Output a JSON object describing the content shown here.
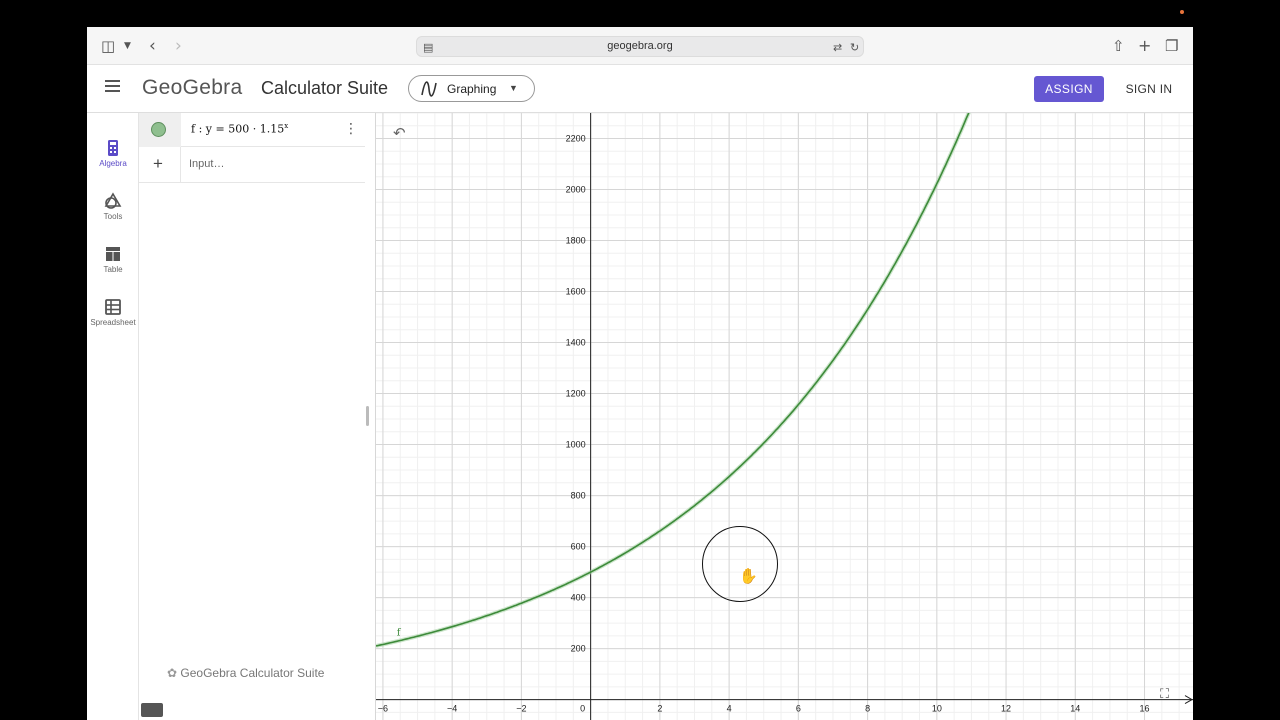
{
  "browser": {
    "url": "geogebra.org",
    "icons": [
      "sidebar-icon",
      "chevron-down-icon",
      "back-icon",
      "forward-icon",
      "site-settings-icon",
      "lock-icon",
      "translate-icon",
      "reload-icon",
      "share-icon",
      "new-tab-icon",
      "tabs-overview-icon"
    ]
  },
  "header": {
    "logo": "GeoGebra",
    "title": "Calculator Suite",
    "app_selector": "Graphing",
    "assign_label": "ASSIGN",
    "signin_label": "SIGN IN",
    "accent": "#6557d2"
  },
  "sidebar": {
    "items": [
      {
        "label": "Algebra",
        "icon": "calculator-icon",
        "active": true
      },
      {
        "label": "Tools",
        "icon": "tools-icon",
        "active": false
      },
      {
        "label": "Table",
        "icon": "table-icon",
        "active": false
      },
      {
        "label": "Spreadsheet",
        "icon": "spreadsheet-icon",
        "active": false
      }
    ]
  },
  "algebra": {
    "name": "f",
    "lhs": "y",
    "coefficient": "500",
    "base": "1.15",
    "exponent": "x",
    "input_placeholder": "Input…",
    "footer": "GeoGebra Calculator Suite",
    "curve_color": "#3d8a3a"
  },
  "graphics": {
    "x_ticks": [
      "−6",
      "−4",
      "−2",
      "0",
      "2",
      "4",
      "6",
      "8",
      "10",
      "12",
      "14",
      "16"
    ],
    "y_ticks": [
      "200",
      "400",
      "600",
      "800",
      "1000",
      "1200",
      "1400",
      "1600",
      "1800",
      "2000",
      "2200"
    ],
    "curve_label": "f"
  },
  "chart_data": {
    "type": "line",
    "title": "",
    "xlabel": "",
    "ylabel": "",
    "xlim": [
      -6.2,
      17.4
    ],
    "ylim": [
      -80,
      2300
    ],
    "grid": true,
    "series": [
      {
        "name": "f",
        "function": "y = 500 · 1.15^x",
        "x": [
          -6,
          -4,
          -2,
          0,
          2,
          4,
          6,
          8,
          10,
          10.9
        ],
        "y": [
          216,
          286,
          378,
          500,
          661,
          875,
          1157,
          1530,
          2023,
          2296
        ]
      }
    ]
  }
}
